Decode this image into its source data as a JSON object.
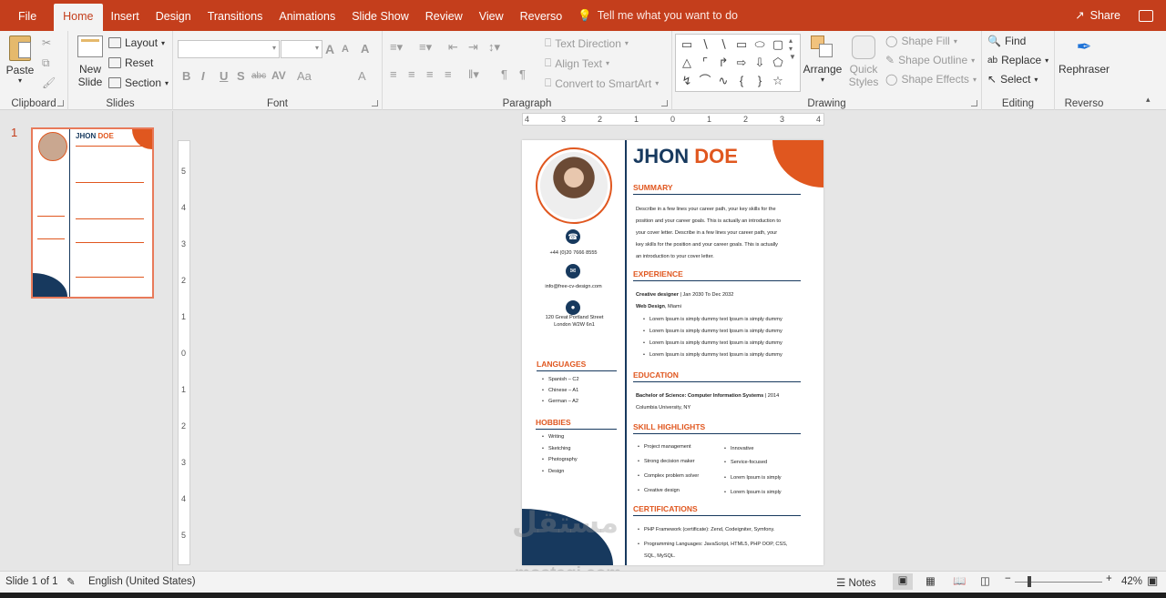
{
  "tabs": [
    "File",
    "Home",
    "Insert",
    "Design",
    "Transitions",
    "Animations",
    "Slide Show",
    "Review",
    "View",
    "Reverso"
  ],
  "tell_me": "Tell me what you want to do",
  "share": "Share",
  "ribbon": {
    "clipboard": {
      "paste": "Paste",
      "label": "Clipboard"
    },
    "slides": {
      "new_slide_1": "New",
      "new_slide_2": "Slide",
      "layout": "Layout",
      "reset": "Reset",
      "section": "Section",
      "label": "Slides"
    },
    "font": {
      "label": "Font",
      "grow": "A",
      "shrink": "A",
      "clear": "A",
      "bold": "B",
      "italic": "I",
      "underline": "U",
      "shadow": "S",
      "strike": "abc",
      "spacing": "AV",
      "case": "Aa",
      "color": "A"
    },
    "paragraph": {
      "label": "Paragraph",
      "text_direction": "Text Direction",
      "align_text": "Align Text",
      "smartart": "Convert to SmartArt"
    },
    "drawing": {
      "label": "Drawing",
      "arrange": "Arrange",
      "quick_styles_1": "Quick",
      "quick_styles_2": "Styles",
      "shape_fill": "Shape Fill",
      "shape_outline": "Shape Outline",
      "shape_effects": "Shape Effects"
    },
    "editing": {
      "label": "Editing",
      "find": "Find",
      "replace": "Replace",
      "select": "Select"
    },
    "reverso": {
      "label": "Reverso",
      "rephraser": "Rephraser"
    }
  },
  "thumb_number": "1",
  "ruler_h": [
    "4",
    "3",
    "2",
    "1",
    "0",
    "1",
    "2",
    "3",
    "4"
  ],
  "ruler_v": [
    "5",
    "4",
    "3",
    "2",
    "1",
    "0",
    "1",
    "2",
    "3",
    "4",
    "5"
  ],
  "resume": {
    "first": "JHON",
    "last": "DOE",
    "phone": "+44 (0)20 7666 8555",
    "email": "info@free-cv-design.com",
    "address1": "120 Great Portland Street",
    "address2": "London W2W 6n1",
    "languages_title": "LANGUAGES",
    "languages": [
      "Spanish – C2",
      "Chinese – A1",
      "German – A2"
    ],
    "hobbies_title": "HOBBIES",
    "hobbies": [
      "Writing",
      "Sketching",
      "Photography",
      "Design"
    ],
    "summary_title": "SUMMARY",
    "summary": [
      "Describe in a few lines your career path, your key skills for the",
      "position and your career goals. This is actually an introduction to",
      "your cover letter. Describe in a few lines your career path, your",
      "key skills for the position and your career goals. This is actually",
      "an introduction to your cover letter."
    ],
    "experience_title": "EXPERIENCE",
    "exp_role": "Creative designer",
    "exp_dates": " | Jan 2030 To Dec 2032",
    "exp_company": "Web Design",
    "exp_city": ", Miami",
    "exp_bullets": [
      "Lorem Ipsum is simply dummy text Ipsum is simply dummy",
      "Lorem Ipsum is simply dummy text Ipsum is simply dummy",
      "Lorem Ipsum is simply dummy text Ipsum is simply dummy",
      "Lorem Ipsum is simply dummy text Ipsum is simply dummy"
    ],
    "education_title": "EDUCATION",
    "edu_degree": "Bachelor of Science: Computer Information Systems",
    " edu_year": "",
    "edu_year2": " | 2014",
    "edu_school": "Columbia University, NY",
    "skills_title": "SKILL HIGHLIGHTS",
    "skills_left": [
      "Project management",
      "Strong decision maker",
      "Complex problem solver",
      "Creative design"
    ],
    "skills_right": [
      "Innovative",
      "Service-focused",
      "Lorem Ipsum is simply",
      "Lorem Ipsum is simply"
    ],
    "cert_title": "CERTIFICATIONS",
    "cert1": "PHP Framework (certificate): Zend, Codeigniter, Symfony.",
    "cert2": "Programming Languages: JavaScript, HTML5, PHP OOP, CSS,",
    "cert3": "SQL, MySQL."
  },
  "watermark": "مستقل",
  "watermark2": "mostaqi.com",
  "status": {
    "slide": "Slide 1 of 1",
    "language": "English (United States)",
    "notes": "Notes",
    "zoom": "42%"
  },
  "colors": {
    "accent": "#c43e1c",
    "navy": "#17395e",
    "orange": "#e0571f"
  }
}
